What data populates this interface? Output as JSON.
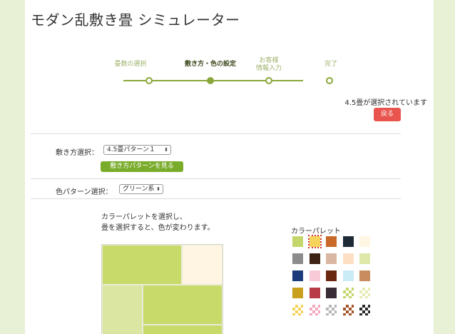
{
  "page_title": "モダン乱敷き畳 シミュレーター",
  "steps": [
    {
      "label": "畳数の選択",
      "active": false
    },
    {
      "label": "敷き方・色の設定",
      "active": true
    },
    {
      "label": "お客様\n情報入力",
      "active": false
    },
    {
      "label": "完了",
      "active": false
    }
  ],
  "status": {
    "selected_text": "4.5畳が選択されています",
    "back_label": "戻る"
  },
  "layout_row": {
    "label": "敷き方選択：",
    "value": "4.5畳パターン１",
    "pattern_button": "敷き方パターンを見る"
  },
  "color_row": {
    "label": "色パターン選択：",
    "value": "グリーン系"
  },
  "instructions": {
    "line1": "カラーパレットを選択し、",
    "line2": "畳を選択すると、色が変わります。"
  },
  "palette": {
    "title": "カラーパレット",
    "colors": [
      [
        "#c3d66c",
        "#f6d35a",
        "#c8692a",
        "#1e2a36",
        "#fff6e4"
      ],
      [
        "#8c8c8c",
        "#3d2314",
        "#d9b7a2",
        "#fde0c3",
        "#dfe8a9"
      ],
      [
        "#1b3b7a",
        "#f8c9d6",
        "#6b2810",
        "#c9ecf6",
        "#c88c5e"
      ],
      [
        "#c9a01e",
        "#b83a47",
        "#3a2c36",
        "#c3d66c",
        "#e6eab0"
      ],
      [
        "#f6d35a",
        "#f1a7bd",
        "#b6b6b6",
        "#a3532a",
        "#2a2a2a"
      ]
    ]
  },
  "tatami_colors": {
    "green": "#c8da6a",
    "cream": "#fff5e2",
    "pale": "#dbe6a2"
  }
}
